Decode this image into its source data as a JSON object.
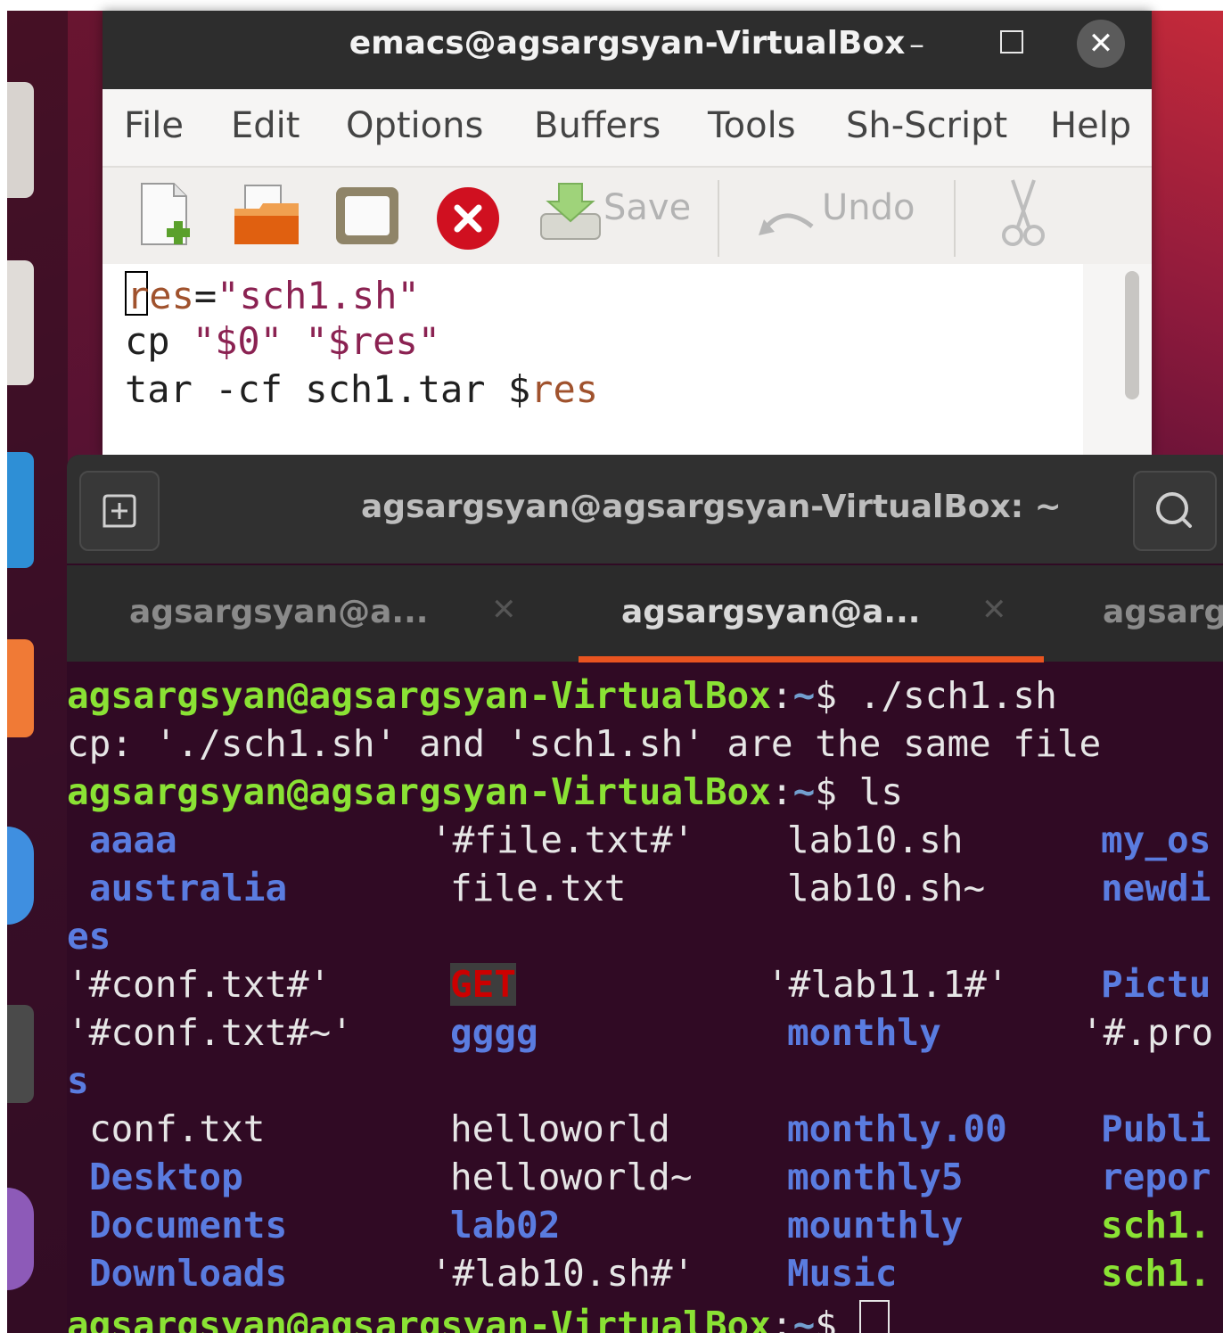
{
  "emacs": {
    "title": "emacs@agsargsyan-VirtualBox",
    "menu": [
      "File",
      "Edit",
      "Options",
      "Buffers",
      "Tools",
      "Sh-Script",
      "Help"
    ],
    "toolbar": {
      "save_label": "Save",
      "undo_label": "Undo"
    },
    "code": {
      "line1_a": "r",
      "line1_b": "es",
      "line1_c": "=",
      "line1_d": "\"sch1.sh\"",
      "line2_a": "cp ",
      "line2_b": "\"$0\"",
      "line2_c": " ",
      "line2_d": "\"$res\"",
      "line3_a": "tar -cf sch1.tar $",
      "line3_b": "res"
    }
  },
  "terminal": {
    "title": "agsargsyan@agsargsyan-VirtualBox: ~",
    "tabs": [
      {
        "label": "agsargsyan@a...",
        "active": false
      },
      {
        "label": "agsargsyan@a...",
        "active": true
      },
      {
        "label": "agsarg",
        "active": false
      }
    ],
    "prompt_user": "agsargsyan@agsargsyan-VirtualBox",
    "prompt_sep": ":",
    "prompt_path": "~",
    "prompt_symbol": "$",
    "cmd1": " ./sch1.sh",
    "error1": "cp: './sch1.sh' and 'sch1.sh' are the same file",
    "cmd2": " ls",
    "listing": {
      "r1": {
        "c1": "aaaa",
        "c2": "'#file.txt#'",
        "c3": "lab10.sh",
        "c4": "my_os"
      },
      "r2": {
        "c1": "australia",
        "c2": "file.txt",
        "c3": "lab10.sh~",
        "c4": "newdi"
      },
      "r2wrap": "es",
      "r3": {
        "c1": "'#conf.txt#'",
        "c2": "GET",
        "c3": "'#lab11.1#'",
        "c4": "Pictu"
      },
      "r4": {
        "c1": "'#conf.txt#~'",
        "c2": "gggg",
        "c3": "monthly",
        "c4": "'#.pro"
      },
      "r4wrap": "s",
      "r5": {
        "c1": "conf.txt",
        "c2": "helloworld",
        "c3": "monthly.00",
        "c4": "Publi"
      },
      "r6": {
        "c1": "Desktop",
        "c2": "helloworld~",
        "c3": "monthly5",
        "c4": "repor"
      },
      "r7": {
        "c1": "Documents",
        "c2": "lab02",
        "c3": "mounthly",
        "c4": "sch1."
      },
      "r8": {
        "c1": "Downloads",
        "c2": "'#lab10.sh#'",
        "c3": "Music",
        "c4": "sch1."
      }
    },
    "colors": {
      "background": "#300a24",
      "prompt": "#8ae234",
      "accent": "#e95420"
    }
  }
}
